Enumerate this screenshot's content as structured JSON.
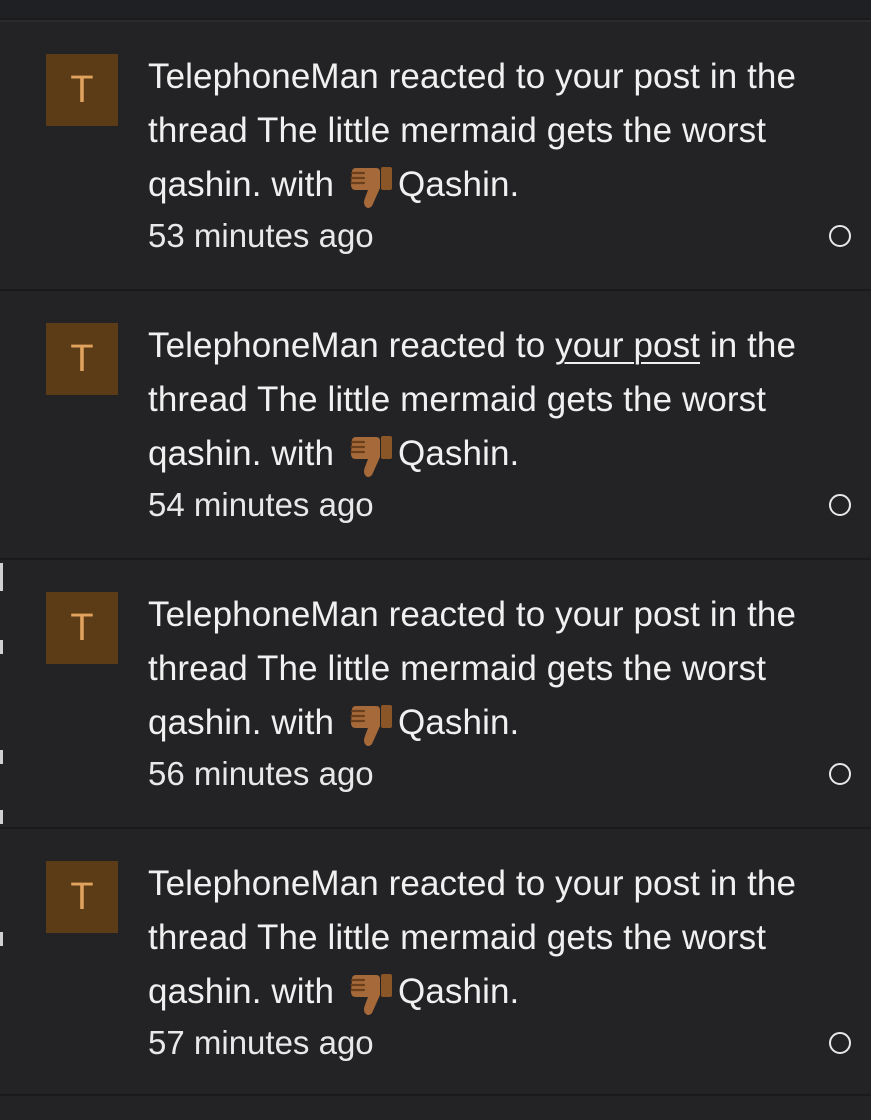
{
  "alerts": [
    {
      "avatar_letter": "T",
      "user": "TelephoneMan",
      "action": "reacted to",
      "post_link": "your post",
      "middle": "in the thread",
      "thread": "The little mermaid gets the worst qashin.",
      "with": "with",
      "reaction_icon": "thumbs-down-icon",
      "reaction": "Qashin.",
      "time": "53 minutes ago"
    },
    {
      "avatar_letter": "T",
      "user": "TelephoneMan",
      "action": "reacted to",
      "post_link": "your post",
      "middle": "in the thread",
      "thread": "The little mermaid gets the worst qashin.",
      "with": "with",
      "reaction_icon": "thumbs-down-icon",
      "reaction": "Qashin.",
      "time": "54 minutes ago"
    },
    {
      "avatar_letter": "T",
      "user": "TelephoneMan",
      "action": "reacted to",
      "post_link": "your post",
      "middle": "in the thread",
      "thread": "The little mermaid gets the worst qashin.",
      "with": "with",
      "reaction_icon": "thumbs-down-icon",
      "reaction": "Qashin.",
      "time": "56 minutes ago"
    },
    {
      "avatar_letter": "T",
      "user": "TelephoneMan",
      "action": "reacted to",
      "post_link": "your post",
      "middle": "in the thread",
      "thread": "The little mermaid gets the worst qashin.",
      "with": "with",
      "reaction_icon": "thumbs-down-icon",
      "reaction": "Qashin.",
      "time": "57 minutes ago"
    }
  ],
  "colors": {
    "background": "#232325",
    "avatar_bg": "#5c3b17",
    "avatar_letter": "#e0a25c",
    "text": "#f0f0f0"
  }
}
